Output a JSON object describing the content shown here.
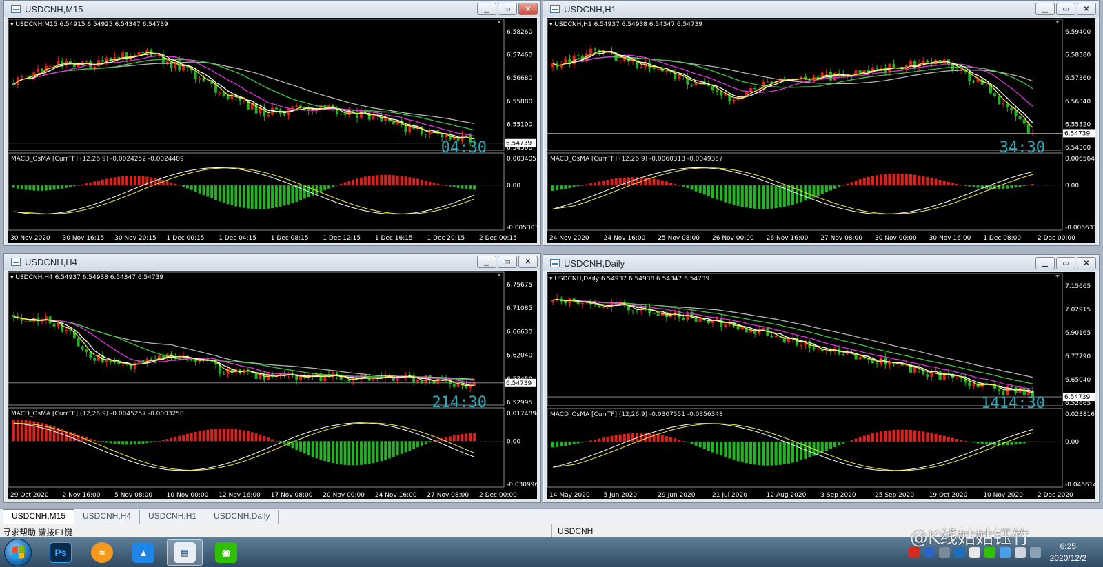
{
  "windows": [
    {
      "title": "USDCNH,M15",
      "header": "USDCNH,M15  6.54915 6.54925 6.54347 6.54739",
      "price_ticks": [
        "6.58260",
        "6.57460",
        "6.56680",
        "6.55880",
        "6.55100",
        "6.54300"
      ],
      "current_price": "6.54739",
      "countdown": "04:30",
      "macd_label": "MACD_OsMA [CurrTF] (12,26,9) -0.0024252 -0.0024489",
      "macd_ticks": [
        "0.003405",
        "0.00",
        "-0.005303"
      ],
      "time_labels": [
        "30 Nov 2020",
        "30 Nov 16:15",
        "30 Nov 20:15",
        "1 Dec 00:15",
        "1 Dec 04:15",
        "1 Dec 08:15",
        "1 Dec 12:15",
        "1 Dec 16:15",
        "1 Dec 20:15",
        "2 Dec 00:15"
      ],
      "close_style": "red",
      "seed": 11,
      "shape": [
        0.55,
        0.75,
        0.72,
        0.85,
        0.7,
        0.45,
        0.28,
        0.32,
        0.3,
        0.18,
        0.08,
        0.04
      ]
    },
    {
      "title": "USDCNH,H1",
      "header": "USDCNH,H1  6.54937 6.54938 6.54347 6.54739",
      "price_ticks": [
        "6.59400",
        "6.58380",
        "6.57360",
        "6.56340",
        "6.55320",
        "6.54300"
      ],
      "current_price": "6.54739",
      "countdown": "34:30",
      "macd_label": "MACD_OsMA [CurrTF] (12,26,9) -0.0060318 -0.0049357",
      "macd_ticks": [
        "0.0065649",
        "0.00",
        "-0.006631"
      ],
      "time_labels": [
        "24 Nov 2020",
        "24 Nov 16:00",
        "25 Nov 08:00",
        "26 Nov 00:00",
        "26 Nov 16:00",
        "27 Nov 08:00",
        "30 Nov 00:00",
        "30 Nov 16:00",
        "1 Dec 08:00",
        "2 Dec 00:00"
      ],
      "close_style": "plain",
      "seed": 23,
      "shape": [
        0.7,
        0.85,
        0.72,
        0.6,
        0.42,
        0.55,
        0.6,
        0.65,
        0.72,
        0.75,
        0.5,
        0.05
      ]
    },
    {
      "title": "USDCNH,H4",
      "header": "USDCNH,H4  6.54937 6.54938 6.54347 6.54739",
      "price_ticks": [
        "6.75675",
        "6.71085",
        "6.66630",
        "6.62040",
        "6.57450",
        "6.52995"
      ],
      "current_price": "6.54739",
      "countdown": "214:30",
      "macd_label": "MACD_OsMA [CurrTF] (12,26,9) -0.0045257 -0.0003250",
      "macd_ticks": [
        "0.0174898",
        "0.00",
        "-0.030996"
      ],
      "time_labels": [
        "29 Oct 2020",
        "2 Nov 16:00",
        "5 Nov 08:00",
        "10 Nov 00:00",
        "12 Nov 16:00",
        "17 Nov 08:00",
        "20 Nov 00:00",
        "24 Nov 16:00",
        "27 Nov 08:00",
        "2 Dec 00:00"
      ],
      "close_style": "plain",
      "seed": 37,
      "shape": [
        0.75,
        0.68,
        0.35,
        0.3,
        0.4,
        0.25,
        0.2,
        0.18,
        0.2,
        0.18,
        0.16,
        0.12
      ]
    },
    {
      "title": "USDCNH,Daily",
      "header": "USDCNH,Daily  6.54937 6.54938 6.54347 6.54739",
      "price_ticks": [
        "7.15665",
        "7.02915",
        "6.90165",
        "6.77790",
        "6.65040",
        "6.52665"
      ],
      "current_price": "6.54739",
      "countdown": "1414:30",
      "macd_label": "MACD_OsMA [CurrTF] (12,26,9) -0.0307551 -0.0356348",
      "macd_ticks": [
        "0.0238169",
        "0.00",
        "-0.046614"
      ],
      "time_labels": [
        "14 May 2020",
        "5 Jun 2020",
        "29 Jun 2020",
        "21 Jul 2020",
        "12 Aug 2020",
        "3 Sep 2020",
        "25 Sep 2020",
        "19 Oct 2020",
        "10 Nov 2020",
        "2 Dec 2020"
      ],
      "close_style": "plain",
      "seed": 53,
      "shape": [
        0.88,
        0.86,
        0.82,
        0.75,
        0.68,
        0.6,
        0.45,
        0.38,
        0.3,
        0.2,
        0.1,
        0.04
      ]
    }
  ],
  "tabs": [
    "USDCNH,M15",
    "USDCNH,H4",
    "USDCNH,H1",
    "USDCNH,Daily"
  ],
  "status": {
    "help": "寻求帮助,请按F1键",
    "symbol": "USDCNH"
  },
  "taskbar": {
    "clock_time": "6:25",
    "clock_date": "2020/12/2",
    "watermark": "@K线姑姑钰竹"
  },
  "colors": {
    "bull": "#e0201a",
    "bear": "#22b422",
    "ma_yellow": "#f4ee3a",
    "ma_white": "#ffffff",
    "ma_magenta": "#e032e0",
    "ma_green": "#3cc83c",
    "ma_gray": "#b4b4b4",
    "countdown": "#2aa9b9"
  }
}
